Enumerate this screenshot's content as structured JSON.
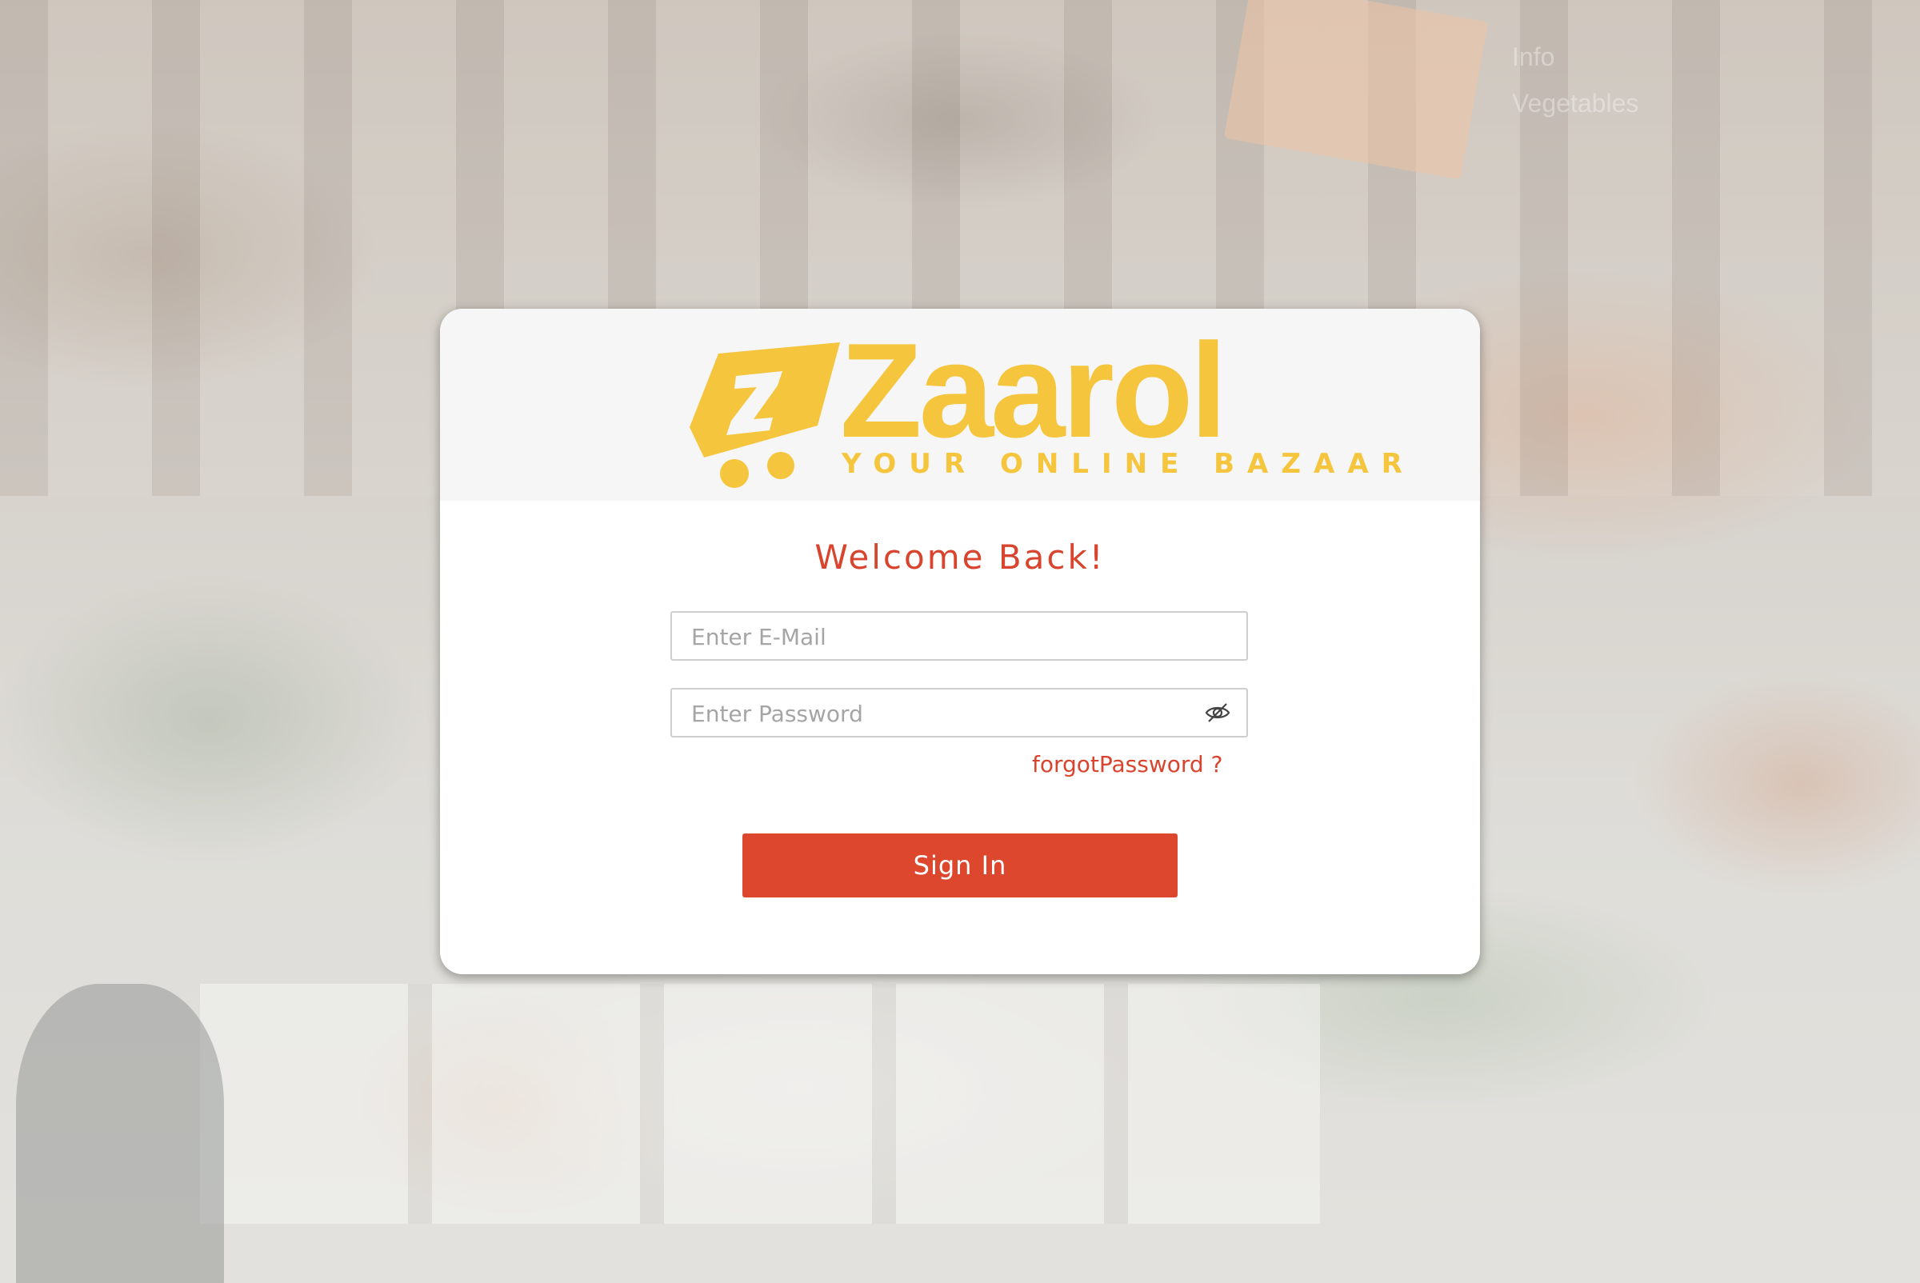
{
  "background": {
    "corner_text_line1": "Info",
    "corner_text_line2": "Vegetables"
  },
  "brand": {
    "name": "Zaarol",
    "tagline": "YOUR ONLINE BAZAAR",
    "color": "#f4c53d"
  },
  "login": {
    "heading": "Welcome Back!",
    "email_placeholder": "Enter E-Mail",
    "email_value": "",
    "password_placeholder": "Enter Password",
    "password_value": "",
    "password_toggle_icon": "eye-off-icon",
    "forgot_label": "forgotPassword ?",
    "signin_label": "Sign In",
    "accent_color": "#dc472e"
  }
}
